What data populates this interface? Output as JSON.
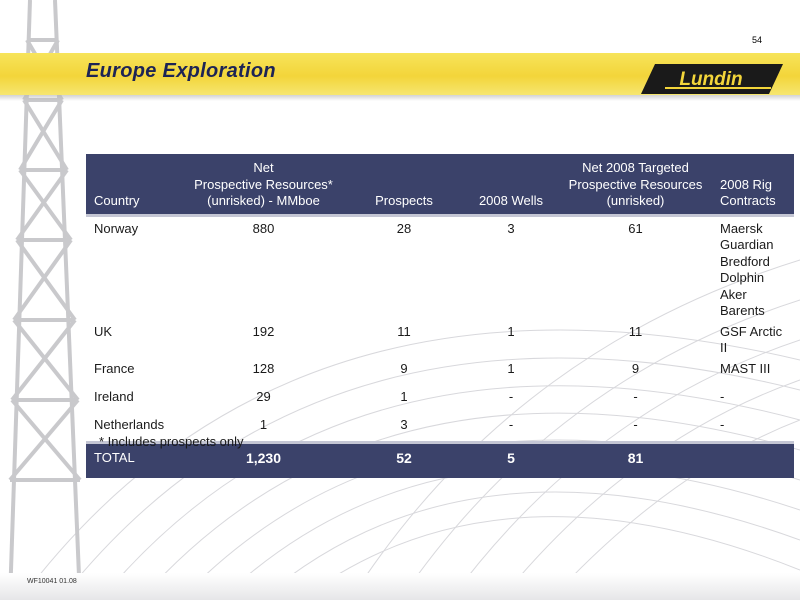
{
  "page_number": "54",
  "title": "Europe Exploration",
  "logo_text": "Lundin",
  "table": {
    "headers": {
      "country": "Country",
      "net_resources": [
        "Net",
        "Prospective Resources*",
        "(unrisked) - MMboe"
      ],
      "prospects": "Prospects",
      "wells": "2008 Wells",
      "targeted": [
        "Net 2008 Targeted",
        "Prospective Resources",
        "(unrisked)"
      ],
      "rig_contracts": "2008 Rig Contracts"
    },
    "rows": [
      {
        "country": "Norway",
        "net_resources": "880",
        "prospects": "28",
        "wells": "3",
        "targeted": "61",
        "rigs": [
          "Maersk Guardian",
          "Bredford Dolphin",
          "Aker Barents"
        ]
      },
      {
        "country": "UK",
        "net_resources": "192",
        "prospects": "11",
        "wells": "1",
        "targeted": "11",
        "rigs": [
          "GSF Arctic II"
        ]
      },
      {
        "country": "France",
        "net_resources": "128",
        "prospects": "9",
        "wells": "1",
        "targeted": "9",
        "rigs": [
          "MAST III"
        ]
      },
      {
        "country": "Ireland",
        "net_resources": "29",
        "prospects": "1",
        "wells": "-",
        "targeted": "-",
        "rigs": [
          "-"
        ]
      },
      {
        "country": "Netherlands",
        "net_resources": "1",
        "prospects": "3",
        "wells": "-",
        "targeted": "-",
        "rigs": [
          "-"
        ]
      }
    ],
    "total": {
      "label": "TOTAL",
      "net_resources": "1,230",
      "prospects": "52",
      "wells": "5",
      "targeted": "81"
    }
  },
  "footnote": "* Includes prospects only",
  "doc_code": "WF10041 01.08",
  "colors": {
    "header_bg": "#3b426a",
    "title_band": "#f3d53a",
    "title_text": "#1d2455",
    "logo_bg": "#1a1a1a",
    "logo_text": "#f3d53a"
  }
}
